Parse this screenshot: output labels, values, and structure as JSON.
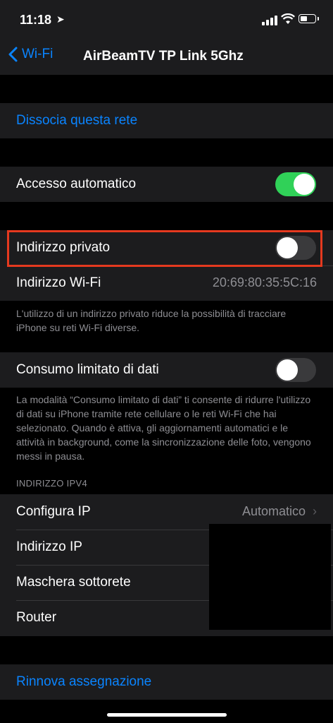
{
  "status_bar": {
    "time": "11:18",
    "location_arrow": "location-arrow-icon"
  },
  "nav": {
    "back_label": "Wi-Fi",
    "title": "AirBeamTV TP Link 5Ghz"
  },
  "forget": {
    "label": "Dissocia questa rete"
  },
  "auto_join": {
    "label": "Accesso automatico",
    "on": true
  },
  "private_address": {
    "label": "Indirizzo privato",
    "on": false
  },
  "wifi_address": {
    "label": "Indirizzo Wi-Fi",
    "value": "20:69:80:35:5C:16"
  },
  "private_note": "L'utilizzo di un indirizzo privato riduce la possibilità di tracciare iPhone su reti Wi-Fi diverse.",
  "low_data": {
    "label": "Consumo limitato di dati",
    "on": false
  },
  "low_data_note": "La modalità “Consumo limitato di dati” ti consente di ridurre l'utilizzo di dati su iPhone tramite rete cellulare o le reti Wi-Fi che hai selezionato. Quando è attiva, gli aggiornamenti automatici e le attività in background, come la sincronizzazione delle foto, vengono messi in pausa.",
  "ipv4": {
    "header": "INDIRIZZO IPV4",
    "configure": {
      "label": "Configura IP",
      "value": "Automatico"
    },
    "ip_address": {
      "label": "Indirizzo IP"
    },
    "subnet_mask": {
      "label": "Maschera sottorete"
    },
    "router": {
      "label": "Router"
    }
  },
  "renew": {
    "label": "Rinnova assegnazione"
  },
  "colors": {
    "accent": "#0a84ff",
    "toggle_on": "#30d158",
    "highlight": "#e5391f"
  }
}
